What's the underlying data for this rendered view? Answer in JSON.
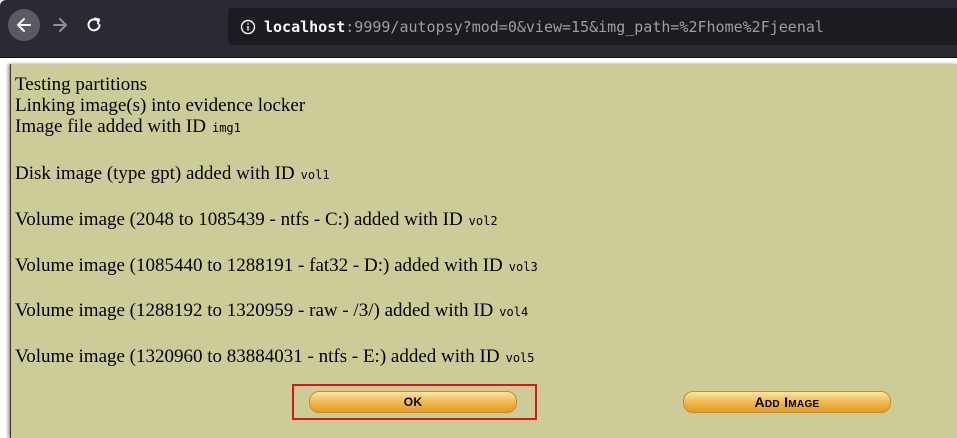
{
  "browser": {
    "url_host": "localhost",
    "url_rest": ":9999/autopsy?mod=0&view=15&img_path=%2Fhome%2Fjeenal"
  },
  "page": {
    "lines": [
      {
        "text": "Testing partitions",
        "id": ""
      },
      {
        "text": "Linking image(s) into evidence locker",
        "id": ""
      },
      {
        "text": "Image file added with ID",
        "id": "img1"
      },
      {
        "text": "Disk image (type gpt) added with ID",
        "id": "vol1"
      },
      {
        "text": "Volume image (2048 to 1085439 - ntfs - C:) added with ID",
        "id": "vol2"
      },
      {
        "text": "Volume image (1085440 to 1288191 - fat32 - D:) added with ID",
        "id": "vol3"
      },
      {
        "text": "Volume image (1288192 to 1320959 - raw - /3/) added with ID",
        "id": "vol4"
      },
      {
        "text": "Volume image (1320960 to 83884031 - ntfs - E:) added with ID",
        "id": "vol5"
      }
    ],
    "ok_label": "OK",
    "add_label": "Add Image"
  },
  "colors": {
    "page_bg": "#cccc99",
    "highlight": "#e2121b",
    "button": "#f0b64a"
  },
  "icons": [
    "back-arrow-icon",
    "forward-arrow-icon",
    "reload-icon",
    "info-icon"
  ]
}
